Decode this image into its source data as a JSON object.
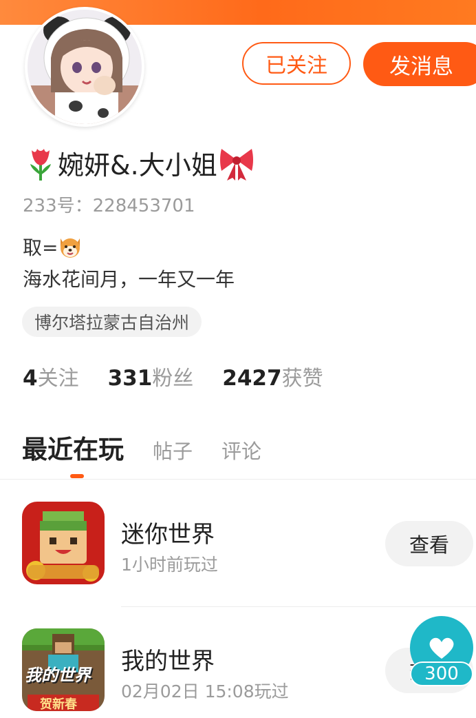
{
  "profile": {
    "nickname": "婉妍&.大小姐",
    "uid_text": "233号：228453701",
    "bio_line1_prefix": "取=",
    "bio_line2": "海水花间月，一年又一年",
    "location": "博尔塔拉蒙古自治州",
    "follow_button": "已关注",
    "message_button": "发消息"
  },
  "stats": [
    {
      "count": "4",
      "label": "关注"
    },
    {
      "count": "331",
      "label": "粉丝"
    },
    {
      "count": "2427",
      "label": "获赞"
    }
  ],
  "tabs": {
    "active": "最近在玩",
    "posts": "帖子",
    "comments": "评论"
  },
  "games": [
    {
      "title": "迷你世界",
      "time": "1小时前玩过",
      "button": "查看",
      "icon": "mini-world-icon"
    },
    {
      "title": "我的世界",
      "time": "02月02日 15:08玩过",
      "button": "查看",
      "icon": "minecraft-icon"
    }
  ],
  "minecraft_icon_text": {
    "logo": "我的世界",
    "banner": "贺新春"
  },
  "float_like": {
    "count": "300"
  },
  "colors": {
    "accent": "#ff5a14",
    "banner": "#ff7a20",
    "like": "#1fb8c8"
  }
}
